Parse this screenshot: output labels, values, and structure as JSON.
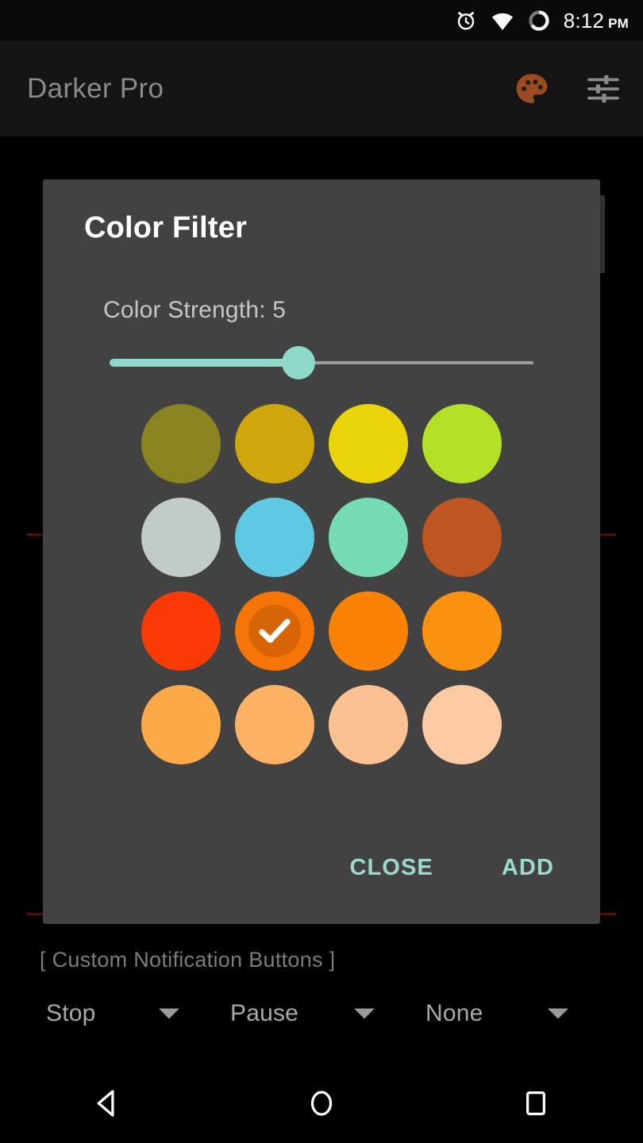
{
  "status_bar": {
    "time": "8:12",
    "ampm": "PM",
    "icons": [
      "alarm-icon",
      "wifi-icon",
      "battery-circle-icon"
    ]
  },
  "app_bar": {
    "title": "Darker Pro",
    "actions": [
      {
        "name": "palette-icon",
        "color": "#9c4a20"
      },
      {
        "name": "tune-icon",
        "color": "#8a8a8a"
      }
    ]
  },
  "page": {
    "section_label": "[ Custom Notification Buttons ]",
    "dropdowns": [
      {
        "value": "Stop"
      },
      {
        "value": "Pause"
      },
      {
        "value": "None"
      }
    ],
    "rule_color": "#5c1410"
  },
  "dialog": {
    "title": "Color Filter",
    "strength_label": "Color Strength: 5",
    "slider": {
      "value": 5,
      "min": 0,
      "max": 11,
      "percent": 44.5,
      "fill_color": "#8fd9ca",
      "track_color": "#9c9c9c"
    },
    "swatches": [
      {
        "color": "#8a8420",
        "selected": false
      },
      {
        "color": "#cfa60b",
        "selected": false
      },
      {
        "color": "#e8d408",
        "selected": false
      },
      {
        "color": "#b5e025",
        "selected": false
      },
      {
        "color": "#c1ccc9",
        "selected": false
      },
      {
        "color": "#5fc9e3",
        "selected": false
      },
      {
        "color": "#76dcb4",
        "selected": false
      },
      {
        "color": "#bf5520",
        "selected": false
      },
      {
        "color": "#f93a05",
        "selected": false
      },
      {
        "color": "#f77407",
        "selected": true
      },
      {
        "color": "#fa8205",
        "selected": false
      },
      {
        "color": "#fc9212",
        "selected": false
      },
      {
        "color": "#fca947",
        "selected": false
      },
      {
        "color": "#fcb265",
        "selected": false
      },
      {
        "color": "#fcc192",
        "selected": false
      },
      {
        "color": "#fccba4",
        "selected": false
      }
    ],
    "buttons": {
      "close": "CLOSE",
      "add": "ADD",
      "accent": "#9ed9cf"
    },
    "background": "#424242"
  },
  "nav_bar": {
    "buttons": [
      "back-icon",
      "home-icon",
      "recents-icon"
    ]
  }
}
